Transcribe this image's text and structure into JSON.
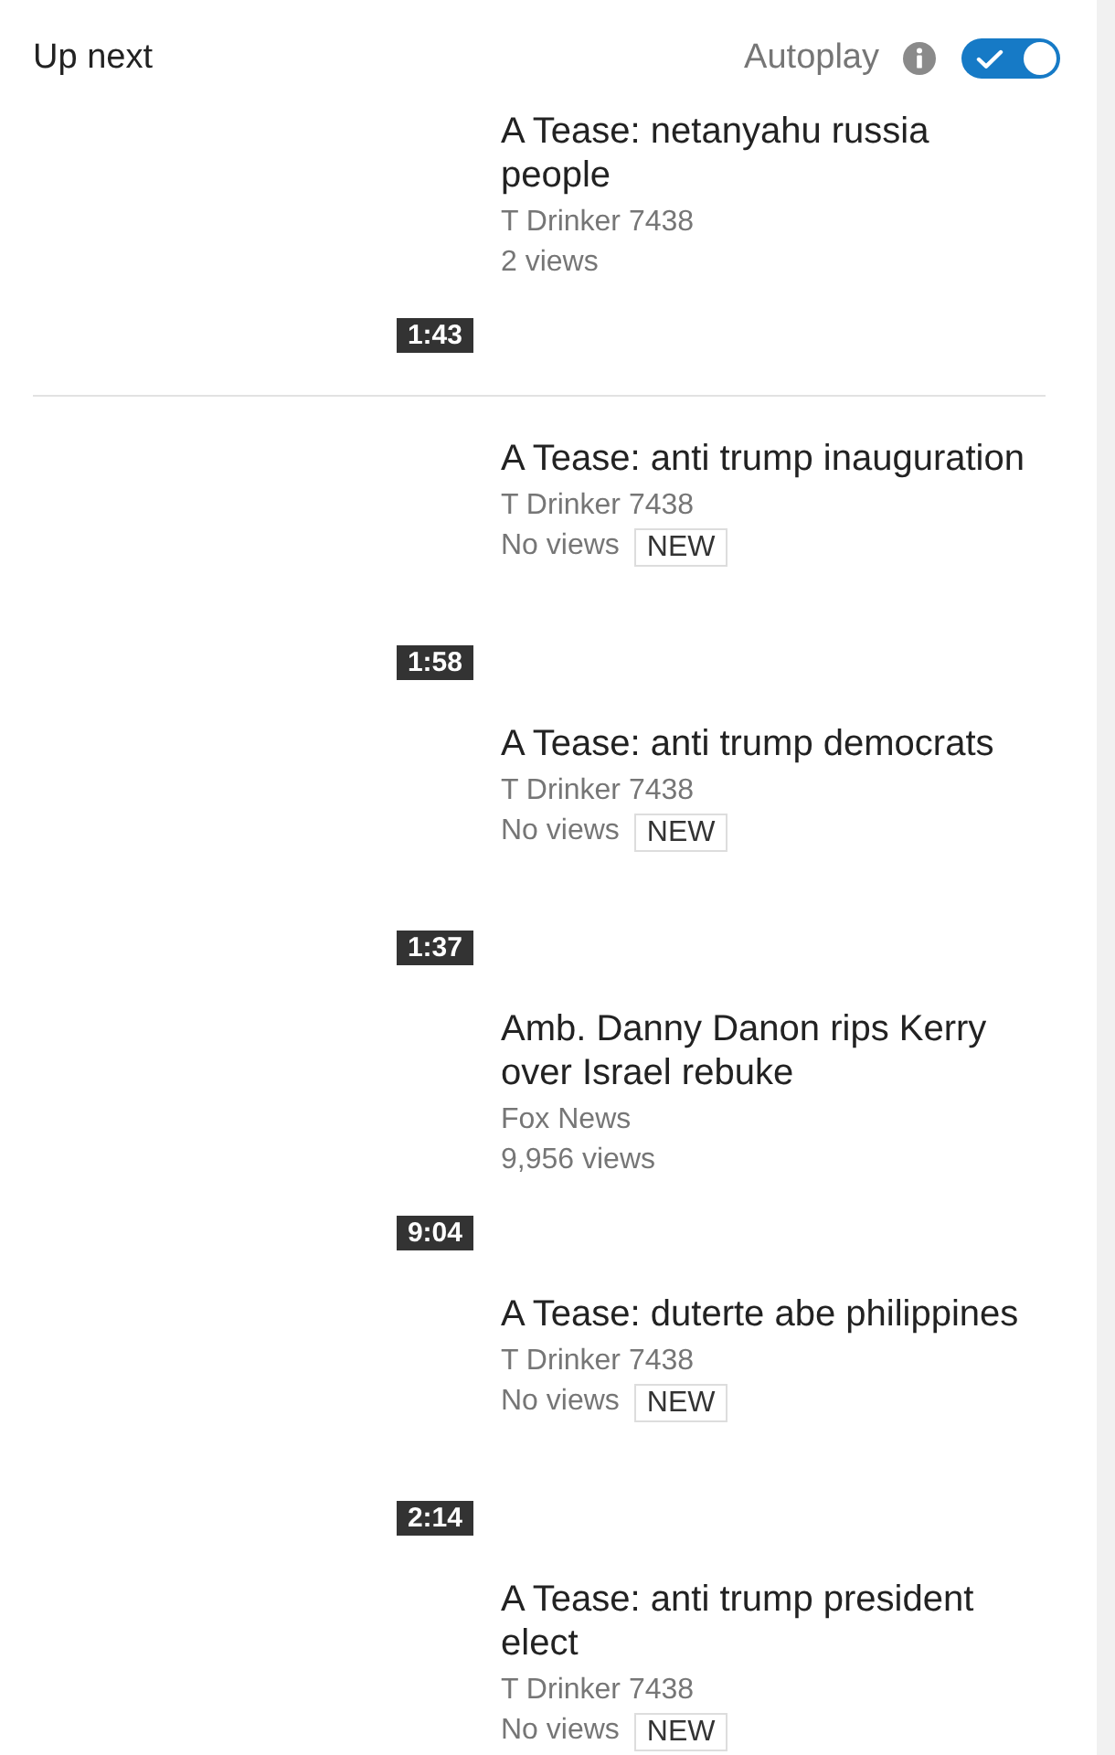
{
  "header": {
    "title": "Up next",
    "autoplay": {
      "label": "Autoplay",
      "on": true
    }
  },
  "up_next": {
    "title": "A Tease: netanyahu russia people",
    "channel": "T Drinker 7438",
    "views": "2 views",
    "duration": "1:43"
  },
  "videos": [
    {
      "title": "A Tease: anti trump inauguration",
      "channel": "T Drinker 7438",
      "views": "No views",
      "badge": "NEW",
      "duration": "1:58"
    },
    {
      "title": "A Tease: anti trump democrats",
      "channel": "T Drinker 7438",
      "views": "No views",
      "badge": "NEW",
      "duration": "1:37"
    },
    {
      "title": "Amb. Danny Danon rips Kerry over Israel rebuke",
      "channel": "Fox News",
      "views": "9,956 views",
      "duration": "9:04"
    },
    {
      "title": "A Tease: duterte abe philippines",
      "channel": "T Drinker 7438",
      "views": "No views",
      "badge": "NEW",
      "duration": "2:14"
    },
    {
      "title": "A Tease: anti trump president elect",
      "channel": "T Drinker 7438",
      "views": "No views",
      "badge": "NEW"
    }
  ]
}
